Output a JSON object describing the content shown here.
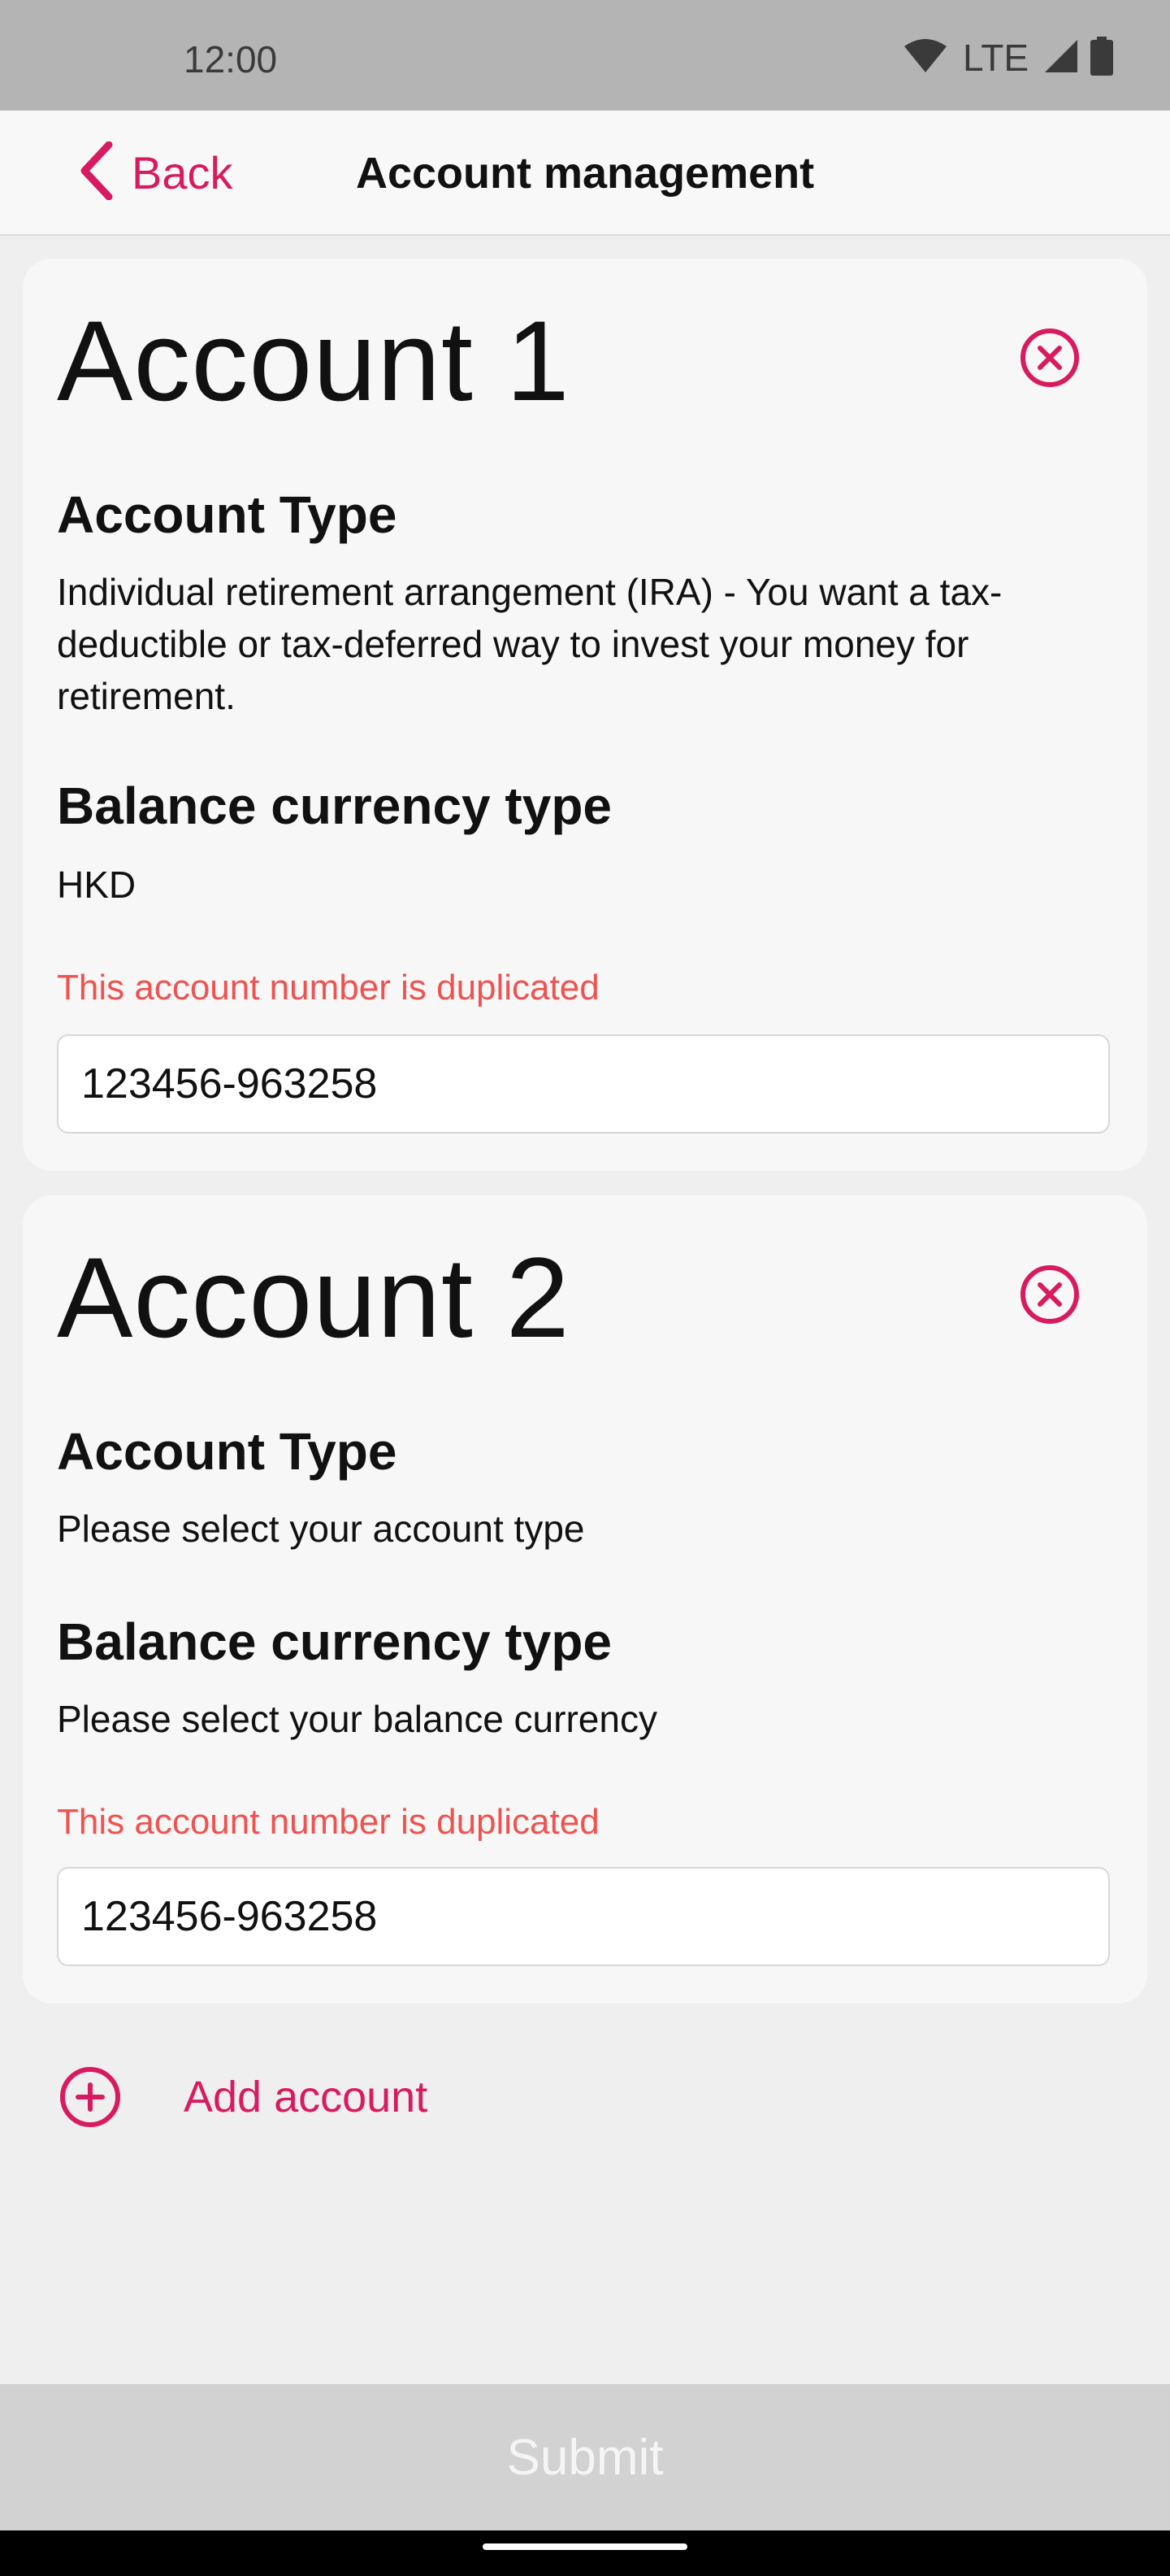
{
  "status_bar": {
    "time": "12:00",
    "network": "LTE",
    "icons": [
      "wifi-icon",
      "signal-icon",
      "battery-icon"
    ]
  },
  "header": {
    "back_label": "Back",
    "title": "Account management",
    "accent_color": "#d81b60"
  },
  "accounts": [
    {
      "title": "Account 1",
      "account_type_label": "Account Type",
      "account_type_value": "Individual retirement arrangement (IRA) - You want a tax-deductible or tax-deferred way to invest your money for retirement.",
      "currency_label": "Balance currency type",
      "currency_value": "HKD",
      "error": "This account number is duplicated",
      "account_number": "123456-963258"
    },
    {
      "title": "Account 2",
      "account_type_label": "Account Type",
      "account_type_value": "Please select your account type",
      "currency_label": "Balance currency type",
      "currency_value": "Please select your balance currency",
      "error": "This account number is duplicated",
      "account_number": "123456-963258"
    }
  ],
  "add_account_label": "Add account",
  "submit_label": "Submit",
  "colors": {
    "accent": "#d81b60",
    "error": "#ef5350",
    "submit_disabled_bg": "#d2d2d2"
  }
}
